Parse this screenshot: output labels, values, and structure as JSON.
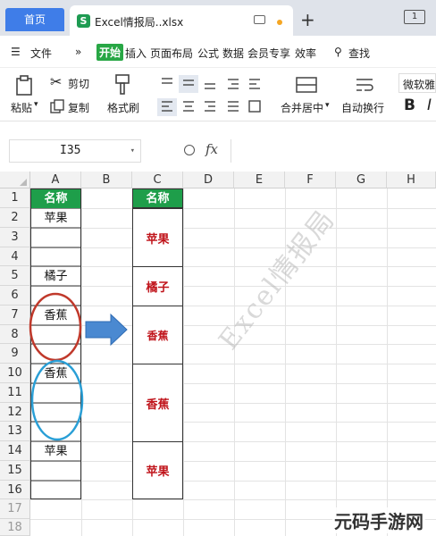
{
  "tabs": {
    "home": "首页",
    "file": "Excel情报局..xlsx"
  },
  "menu": {
    "file": "文件",
    "more": "»",
    "items": [
      "开始",
      "插入",
      "页面布局",
      "公式",
      "数据",
      "会员专享",
      "效率"
    ],
    "search": "查找"
  },
  "ribbon": {
    "paste": "粘贴",
    "cut": "剪切",
    "copy": "复制",
    "format_painter": "格式刷",
    "merge": "合并居中",
    "wrap": "自动换行",
    "font": "微软雅",
    "bold": "B"
  },
  "formula": {
    "cell_ref": "I35",
    "fx": "fx",
    "value": ""
  },
  "columns": [
    "A",
    "B",
    "C",
    "D",
    "E",
    "F",
    "G",
    "H"
  ],
  "rows": [
    "1",
    "2",
    "3",
    "4",
    "5",
    "6",
    "7",
    "8",
    "9",
    "10",
    "11",
    "12",
    "13",
    "14",
    "15",
    "16",
    "17",
    "18"
  ],
  "colA": {
    "header": "名称",
    "r2": "苹果",
    "r6": "橘子",
    "r7": "香蕉",
    "r10": "香蕉",
    "r14": "苹果"
  },
  "colC": {
    "header": "名称",
    "m1": "苹果",
    "m2": "橘子",
    "m3": "香蕉",
    "m4": "香蕉",
    "m5": "苹果"
  },
  "watermark": "Excel情报局",
  "site_mark": "元码手游网",
  "colors": {
    "header_green": "#1e9e4a",
    "merged_text": "#c0141b",
    "oval_red": "#c0392b",
    "oval_blue": "#2a9fd6",
    "arrow_blue": "#4a89d1",
    "home_tab": "#3f7de8"
  }
}
